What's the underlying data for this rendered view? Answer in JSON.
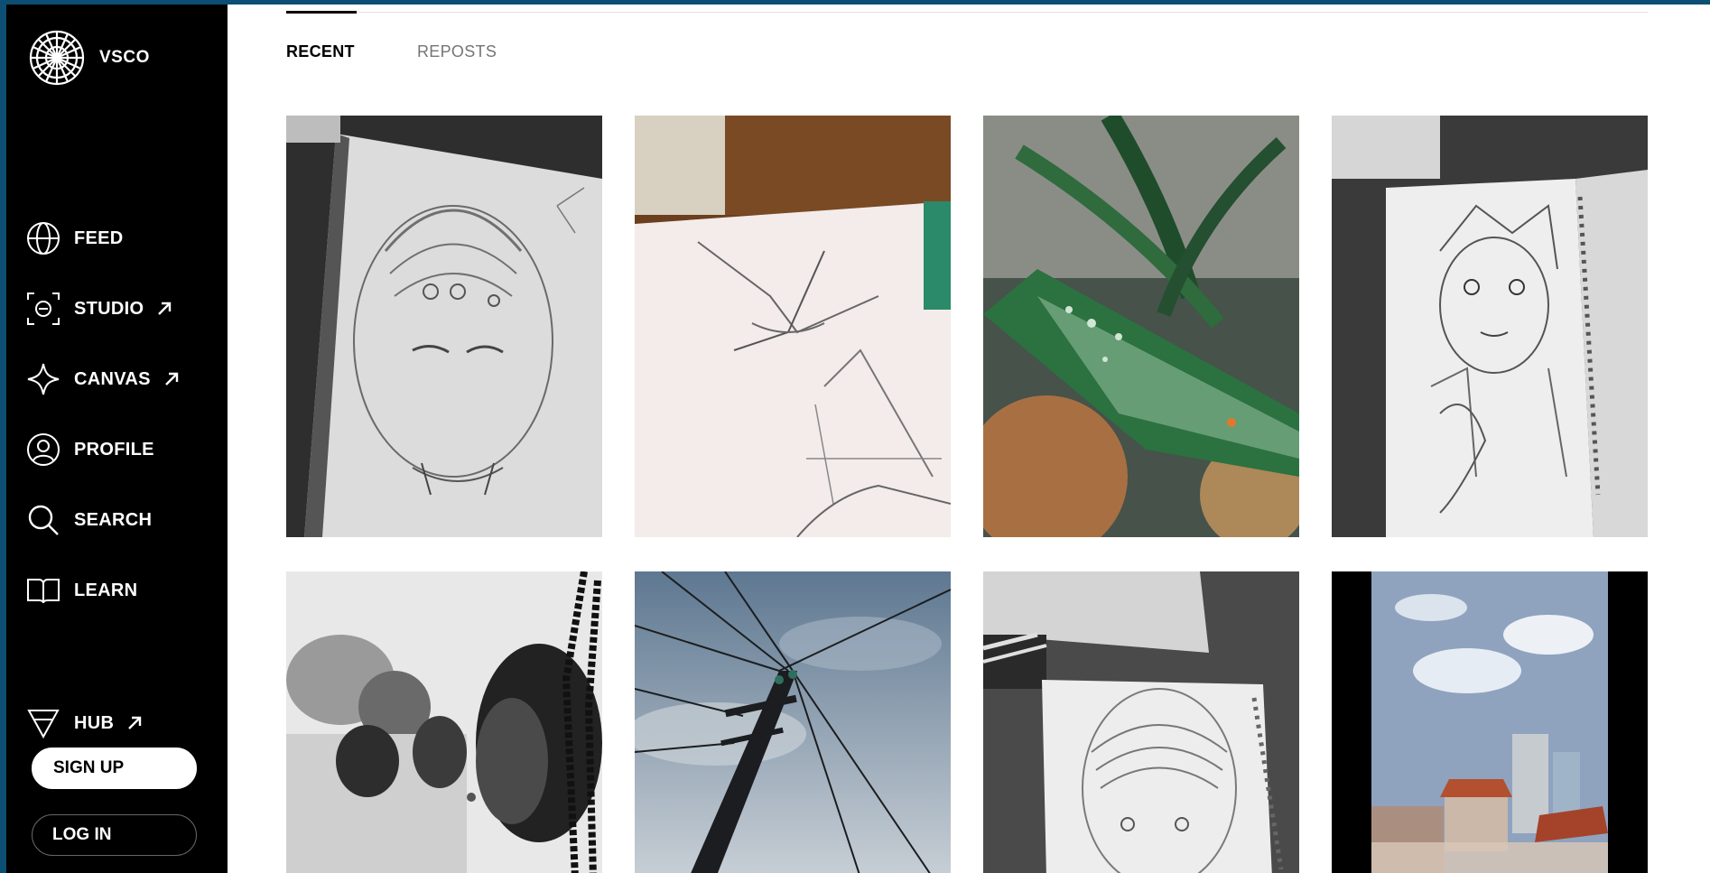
{
  "brand": {
    "name": "VSCO",
    "logo_icon": "vsco-aperture-logo"
  },
  "nav": {
    "items": [
      {
        "label": "FEED",
        "icon": "globe-icon",
        "external": false
      },
      {
        "label": "STUDIO",
        "icon": "studio-frame-icon",
        "external": true
      },
      {
        "label": "CANVAS",
        "icon": "sparkle-icon",
        "external": true
      },
      {
        "label": "PROFILE",
        "icon": "profile-icon",
        "external": false
      },
      {
        "label": "SEARCH",
        "icon": "search-icon",
        "external": false
      },
      {
        "label": "LEARN",
        "icon": "book-icon",
        "external": false
      }
    ],
    "hub": {
      "label": "HUB",
      "icon": "hub-triangle-icon",
      "external": true
    },
    "signup_label": "SIGN UP",
    "login_label": "LOG IN"
  },
  "tabs": [
    {
      "label": "RECENT",
      "active": true
    },
    {
      "label": "REPOSTS",
      "active": false
    }
  ],
  "colors": {
    "background_frame": "#0d4f73",
    "sidebar": "#000000",
    "accent_text": "#ffffff",
    "inactive_tab": "#757575"
  },
  "photos": [
    {
      "subject": "pencil sketch of ape with helmet",
      "tone": "grayscale"
    },
    {
      "subject": "pencil sketch of flying bird",
      "tone": "warm"
    },
    {
      "subject": "green plant leaf with water droplets",
      "tone": "color"
    },
    {
      "subject": "pencil sketch of anime boy",
      "tone": "grayscale"
    },
    {
      "subject": "woman with braids in crowd",
      "tone": "grayscale"
    },
    {
      "subject": "electric pole against cloudy sky",
      "tone": "color"
    },
    {
      "subject": "pencil sketch of ape in notebook",
      "tone": "grayscale"
    },
    {
      "subject": "city rooftops and clouds",
      "tone": "color"
    }
  ]
}
